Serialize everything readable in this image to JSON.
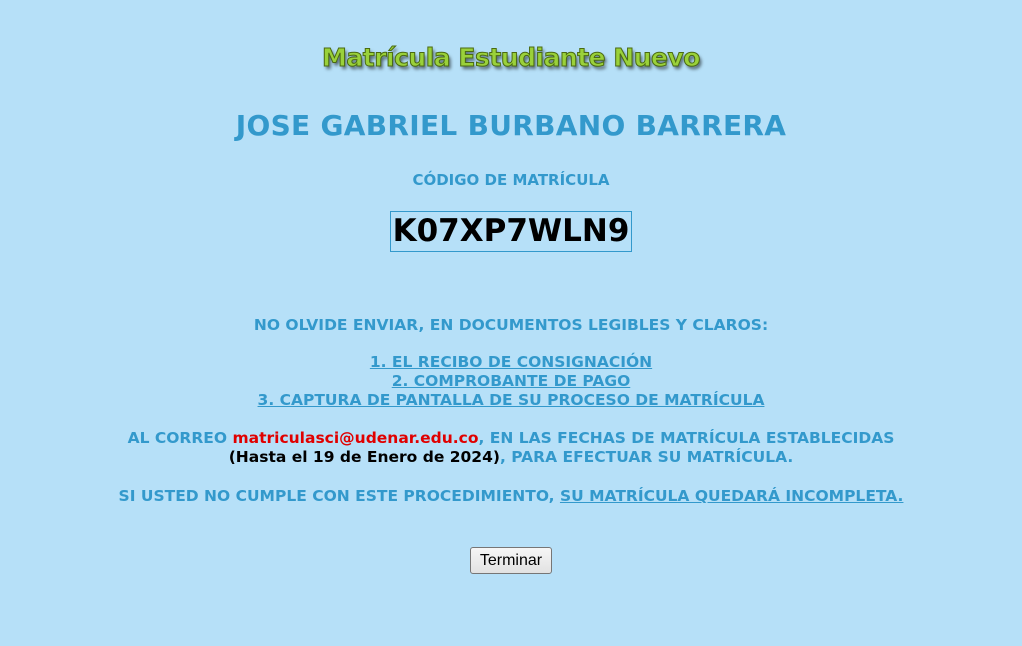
{
  "banner": {
    "title": "Matrícula Estudiante Nuevo"
  },
  "student": {
    "name": "JOSE GABRIEL BURBANO BARRERA"
  },
  "enrollment": {
    "code_label": "CÓDIGO DE MATRÍCULA",
    "code": "K07XP7WLN9"
  },
  "instructions": {
    "reminder": "NO OLVIDE ENVIAR, EN DOCUMENTOS LEGIBLES Y CLAROS:",
    "documents": [
      "1. EL RECIBO DE CONSIGNACIÓN",
      "2. COMPROBANTE DE PAGO",
      "3. CAPTURA DE PANTALLA DE SU PROCESO DE MATRÍCULA"
    ],
    "email_prefix": "AL CORREO ",
    "email": "matriculasci@udenar.edu.co",
    "email_suffix": ", EN LAS FECHAS DE MATRÍCULA ESTABLECIDAS",
    "deadline": "(Hasta el 19 de Enero de 2024)",
    "deadline_suffix": ", PARA EFECTUAR SU MATRÍCULA.",
    "warning_prefix": "SI USTED NO CUMPLE CON ESTE PROCEDIMIENTO, ",
    "warning_emphasis": "SU MATRÍCULA QUEDARÁ INCOMPLETA."
  },
  "actions": {
    "finish_label": "Terminar"
  },
  "colors": {
    "background": "#b6e0f8",
    "accent": "#3399cc",
    "email": "#e00000",
    "banner": "#9ad13a"
  }
}
